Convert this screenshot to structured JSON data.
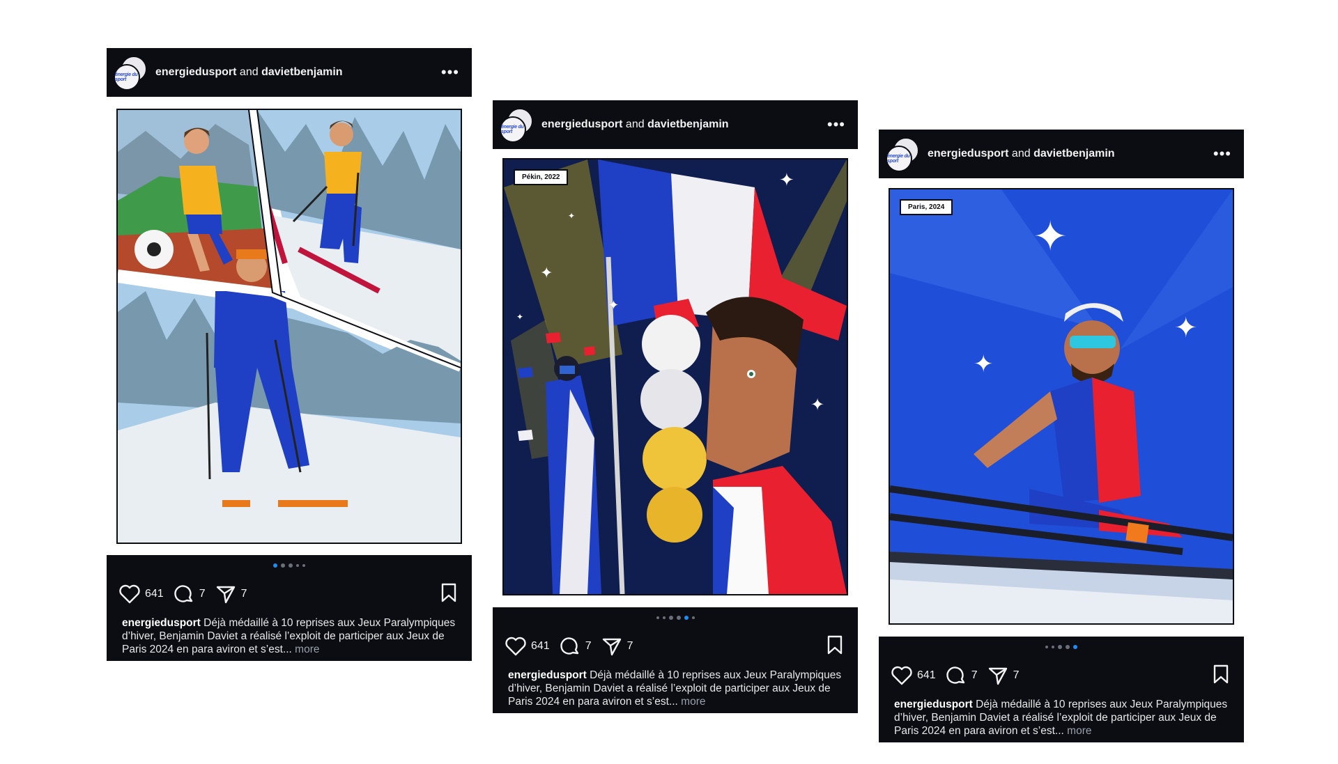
{
  "posts": [
    {
      "account": "energiedusport",
      "connector": "and",
      "collaborator": "davietbenjamin",
      "avatar_text": "énergie du sport",
      "tag": "",
      "likes": "641",
      "comments": "7",
      "shares": "7",
      "caption_user": "energiedusport",
      "caption_text": "Déjà médaillé à 10 reprises aux Jeux Paralympiques d’hiver, Benjamin Daviet a réalisé l’exploit de participer aux Jeux de Paris 2024 en para aviron et s’est...",
      "more": "more",
      "carousel_active_index": 0
    },
    {
      "account": "energiedusport",
      "connector": "and",
      "collaborator": "davietbenjamin",
      "avatar_text": "énergie du sport",
      "tag": "Pékin, 2022",
      "likes": "641",
      "comments": "7",
      "shares": "7",
      "caption_user": "energiedusport",
      "caption_text": "Déjà médaillé à 10 reprises aux Jeux Paralympiques d’hiver, Benjamin Daviet a réalisé l’exploit de participer aux Jeux de Paris 2024 en para aviron et s’est...",
      "more": "more",
      "carousel_active_index": 4
    },
    {
      "account": "energiedusport",
      "connector": "and",
      "collaborator": "davietbenjamin",
      "avatar_text": "énergie du sport",
      "tag": "Paris, 2024",
      "likes": "641",
      "comments": "7",
      "shares": "7",
      "caption_user": "energiedusport",
      "caption_text": "Déjà médaillé à 10 reprises aux Jeux Paralympiques d’hiver, Benjamin Daviet a réalisé l’exploit de participer aux Jeux de Paris 2024 en para aviron et s’est...",
      "more": "more",
      "carousel_active_index": 4
    }
  ],
  "colors": {
    "card_bg": "#0b0d12",
    "active_dot": "#1e8cf0",
    "france_blue": "#1f3fc4",
    "france_red": "#e8202f"
  }
}
